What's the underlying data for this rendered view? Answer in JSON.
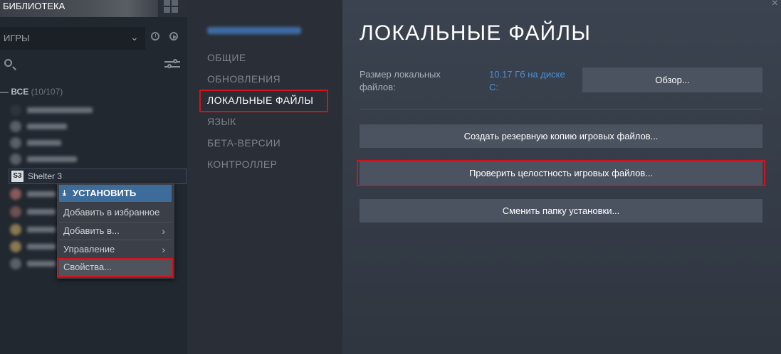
{
  "library": {
    "title": "БИБЛИОТЕКА",
    "filter_select": "ИГРЫ",
    "all": {
      "label": "ВСЕ",
      "count": "(10/107)"
    },
    "selected_game": {
      "icon_text": "S3",
      "name": "Shelter 3"
    },
    "context_menu": {
      "install": "УСТАНОВИТЬ",
      "add_favorites": "Добавить в избранное",
      "add_to": "Добавить в...",
      "manage": "Управление",
      "properties": "Свойства..."
    }
  },
  "dialog": {
    "nav": {
      "general": "ОБЩИЕ",
      "updates": "ОБНОВЛЕНИЯ",
      "local_files": "ЛОКАЛЬНЫЕ ФАЙЛЫ",
      "language": "ЯЗЫК",
      "betas": "БЕТА-ВЕРСИИ",
      "controller": "КОНТРОЛЛЕР"
    },
    "title": "ЛОКАЛЬНЫЕ ФАЙЛЫ",
    "size_label": "Размер локальных файлов:",
    "size_value": "10.17 Гб на диске C:",
    "browse_button": "Обзор...",
    "backup_button": "Создать резервную копию игровых файлов...",
    "verify_button": "Проверить целостность игровых файлов...",
    "move_button": "Сменить папку установки...",
    "close_glyph": "×"
  },
  "colors": {
    "highlight": "#d0131d",
    "link": "#4a8fd8",
    "accent_install": "#3d6b9a"
  },
  "icons": [
    "grid-view-icon",
    "chevron-down-icon",
    "clock-icon",
    "play-icon",
    "search-icon",
    "filter-icon",
    "download-icon",
    "chevron-right-icon",
    "close-icon"
  ]
}
